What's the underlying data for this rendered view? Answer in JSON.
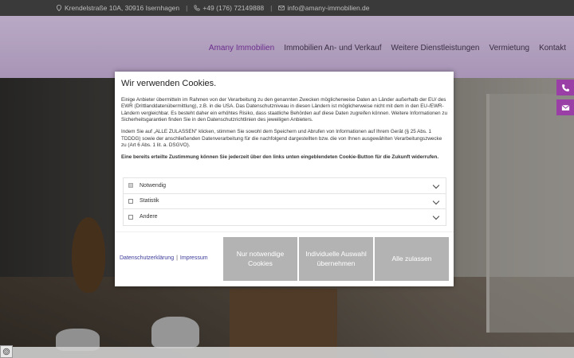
{
  "topbar": {
    "address": "Krendelstraße 10A, 30916 Isernhagen",
    "phone": "+49 (176) 72149888",
    "email": "info@amany-immobilien.de"
  },
  "nav": {
    "items": [
      "Amany Immobilien",
      "Immobilien An- und Verkauf",
      "Weitere Dienstleistungen",
      "Vermietung",
      "Kontakt"
    ]
  },
  "cookie": {
    "title": "Wir verwenden Cookies.",
    "paragraph1": "Einige Anbieter übermitteln im Rahmen von der Verarbeitung zu den genannten Zwecken möglicherweise Daten an Länder außerhalb der EU/ des EWR (Drittlanddatenübermittlung), z.B. in die USA. Das Datenschutzniveau in diesen Ländern ist möglicherweise nicht mit dem in den EU-/EWR-Ländern vergleichbar. Es besteht daher ein erhöhtes Risiko, dass staatliche Behörden auf diese Daten zugreifen können. Weitere Informationen zu Sicherheitsgarantien finden Sie in den Datenschutzrichtlinien des jeweiligen Anbieters.",
    "paragraph2": "Indem Sie auf „ALLE ZULASSEN\" klicken, stimmen Sie sowohl dem Speichern und Abrufen von Informationen auf Ihrem Gerät (§ 25 Abs. 1 TDDDG) sowie der anschließenden Datenverarbeitung für die nachfolgend dargestellten bzw. die von Ihnen ausgewählten Verarbeitungszwecke zu (Art 6 Abs. 1 lit. a. DSGVO).",
    "paragraph3": "Eine bereits erteilte Zustimmung können Sie jederzeit über den links unten eingeblendeten Cookie-Button für die Zukunft widerrufen.",
    "categories": [
      "Notwendig",
      "Statistik",
      "Andere"
    ],
    "link_privacy": "Datenschutzerklärung",
    "link_imprint": "Impressum",
    "btn_necessary": "Nur notwendige Cookies",
    "btn_individual": "Individuelle Auswahl übernehmen",
    "btn_all": "Alle zulassen"
  },
  "colors": {
    "accent": "#9a3fa6",
    "button": "#b3b3b3"
  },
  "icons": {
    "phone": "phone-icon",
    "mail": "mail-icon",
    "location": "location-icon",
    "fingerprint": "fingerprint-icon"
  }
}
